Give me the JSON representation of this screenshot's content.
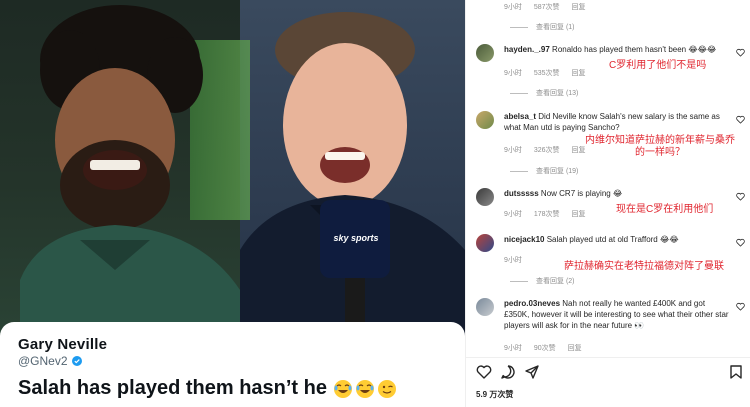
{
  "tweet": {
    "name": "Gary Neville",
    "handle": "@GNev2",
    "text": "Salah has played them hasn’t he",
    "emojis": "laughing-face laughing-face winking-face"
  },
  "mic_brand": "sky sports",
  "top": {
    "meta_time": "9小时",
    "meta_likes": "587次赞",
    "meta_reply": "回复",
    "view_replies": "查看回复 (1)"
  },
  "comments": [
    {
      "user": "hayden._.97",
      "text": "Ronaldo has played them hasn't been 😂😂😂",
      "time": "9小时",
      "likes": "535次赞",
      "reply": "回复",
      "view_replies": "查看回复 (13)",
      "translation": "C罗利用了他们不是吗"
    },
    {
      "user": "abelsa_t",
      "text": "Did Neville know Salah's new salary is the same as what Man utd is paying Sancho?",
      "time": "9小时",
      "likes": "326次赞",
      "reply": "回复",
      "view_replies": "查看回复 (19)",
      "translation": "内维尔知道萨拉赫的新年薪与桑乔的一样吗？",
      "translation_line1": "内维尔知道萨拉赫的新年薪与桑乔",
      "translation_line2": "的一样吗？"
    },
    {
      "user": "dutsssss",
      "text": "Now CR7 is playing 😂",
      "time": "9小时",
      "likes": "178次赞",
      "reply": "回复",
      "translation": "现在是C罗在利用他们"
    },
    {
      "user": "nicejack10",
      "text": "Salah played utd at old Trafford 😂😂",
      "time": "9小时",
      "likes": "",
      "reply": "",
      "view_replies": "查看回复 (2)",
      "translation": "萨拉赫确实在老特拉福德对阵了曼联"
    },
    {
      "user": "pedro.03neves",
      "text": "Nah not really he wanted £400K and got £350K, however it will be interesting to see what their other star players will ask for in the near future 👀",
      "time": "9小时",
      "likes": "90次赞",
      "reply": "回复"
    }
  ],
  "likes_total": "5.9 万次赞",
  "icons": [
    "heart-icon",
    "comment-icon",
    "share-icon",
    "bookmark-icon",
    "verified-icon"
  ],
  "colors": {
    "translation": "#e0262f",
    "verified": "#1d9bf0",
    "meta": "#8e8e8e"
  }
}
